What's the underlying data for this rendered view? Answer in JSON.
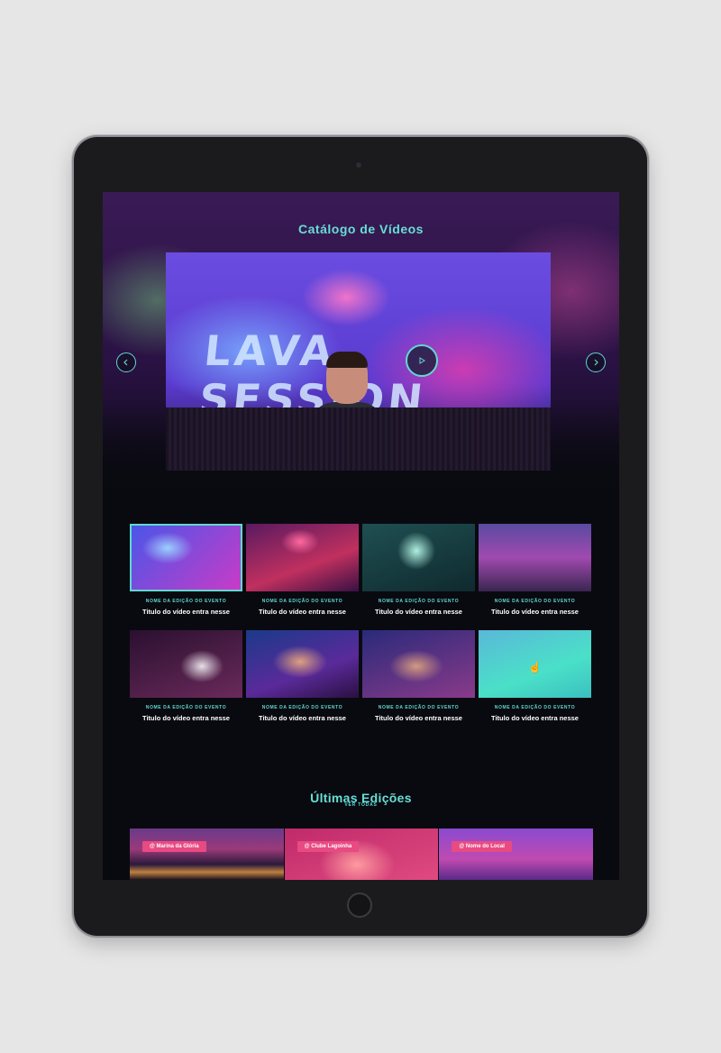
{
  "colors": {
    "accent": "#5fd9d0",
    "tag": "#e84a82",
    "background": "#090a10"
  },
  "hero": {
    "title": "Catálogo de Vídeos",
    "video_text": "LAVA SESSION",
    "prev_icon": "chevron-left-icon",
    "next_icon": "chevron-right-icon",
    "play_icon": "play-icon"
  },
  "videos": [
    {
      "event": "Nome da edição do evento",
      "title": "Titulo do vídeo entra nesse",
      "selected": true
    },
    {
      "event": "Nome da edição do evento",
      "title": "Titulo do vídeo entra nesse"
    },
    {
      "event": "Nome da edição do evento",
      "title": "Titulo do vídeo entra nesse"
    },
    {
      "event": "Nome da edição do evento",
      "title": "Titulo do vídeo entra nesse"
    },
    {
      "event": "Nome da edição do evento",
      "title": "Titulo do vídeo entra nesse"
    },
    {
      "event": "Nome da edição do evento",
      "title": "Titulo do vídeo entra nesse"
    },
    {
      "event": "Nome da edição do evento",
      "title": "Titulo do vídeo entra nesse"
    },
    {
      "event": "Nome da edição do evento",
      "title": "Titulo do vídeo entra nesse"
    }
  ],
  "editions": {
    "title": "Últimas Edições",
    "link": "VER TODAS",
    "items": [
      {
        "tag": "@ Marina da Glória"
      },
      {
        "tag": "@ Clube Lagoinha"
      },
      {
        "tag": "@ Nome do Local"
      }
    ]
  }
}
